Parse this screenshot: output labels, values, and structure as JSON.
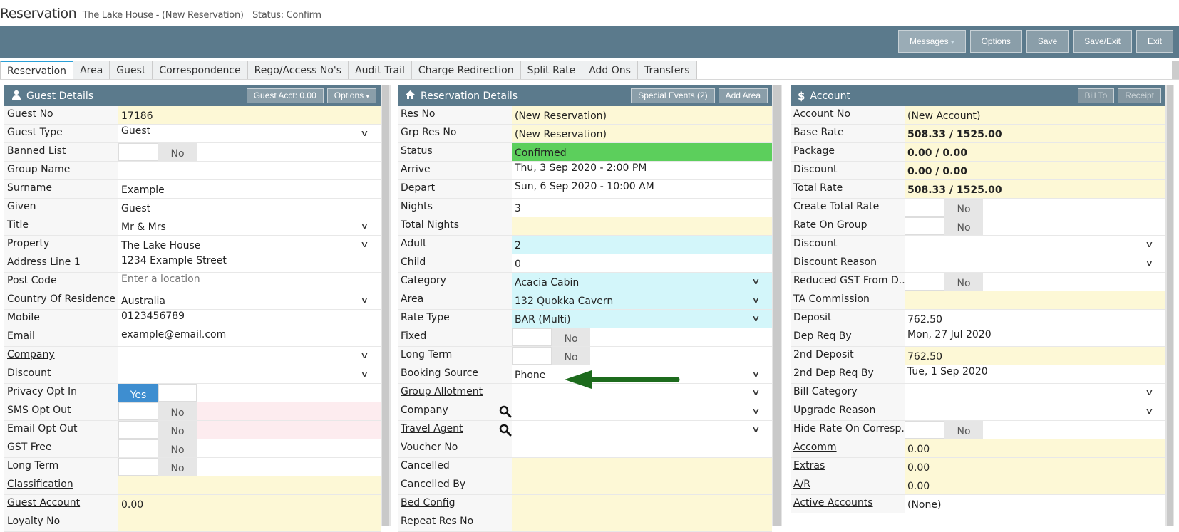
{
  "title": {
    "main": "Reservation",
    "property": "The Lake House - (New Reservation)",
    "status": "Status: Confirm"
  },
  "toolbar": {
    "buttons": [
      "Messages",
      "Options",
      "Save",
      "Save/Exit",
      "Exit"
    ]
  },
  "tabs": [
    "Reservation",
    "Area",
    "Guest",
    "Correspondence",
    "Rego/Access No's",
    "Audit Trail",
    "Charge Redirection",
    "Split Rate",
    "Add Ons",
    "Transfers"
  ],
  "guest": {
    "title": "Guest Details",
    "btn_acct": "Guest Acct: 0.00",
    "btn_options": "Options",
    "rows": [
      {
        "label": "Guest No",
        "value": "17186"
      },
      {
        "label": "Guest Type",
        "value": "Guest"
      },
      {
        "label": "Banned List",
        "value": "No"
      },
      {
        "label": "Group Name",
        "value": ""
      },
      {
        "label": "Surname",
        "value": "Example"
      },
      {
        "label": "Given",
        "value": "Guest"
      },
      {
        "label": "Title",
        "value": "Mr & Mrs"
      },
      {
        "label": "Property",
        "value": "The Lake House"
      },
      {
        "label": "Address Line 1",
        "value": "1234 Example Street"
      },
      {
        "label": "Post Code",
        "value": "Enter a location"
      },
      {
        "label": "Country Of Residence",
        "value": "Australia"
      },
      {
        "label": "Mobile",
        "value": "0123456789"
      },
      {
        "label": "Email",
        "value": "example@email.com"
      },
      {
        "label": "Company",
        "value": ""
      },
      {
        "label": "Discount",
        "value": ""
      },
      {
        "label": "Privacy Opt In",
        "value": "Yes"
      },
      {
        "label": "SMS Opt Out",
        "value": "No"
      },
      {
        "label": "Email Opt Out",
        "value": "No"
      },
      {
        "label": "GST Free",
        "value": "No"
      },
      {
        "label": "Long Term",
        "value": "No"
      },
      {
        "label": "Classification",
        "value": ""
      },
      {
        "label": "Guest Account",
        "value": "0.00"
      },
      {
        "label": "Loyalty No",
        "value": ""
      }
    ]
  },
  "res": {
    "title": "Reservation Details",
    "btn_events": "Special Events (2)",
    "btn_area": "Add Area",
    "rows": [
      {
        "label": "Res No",
        "value": "(New Reservation)"
      },
      {
        "label": "Grp Res No",
        "value": "(New Reservation)"
      },
      {
        "label": "Status",
        "value": "Confirmed"
      },
      {
        "label": "Arrive",
        "value": "Thu, 3 Sep 2020 - 2:00 PM"
      },
      {
        "label": "Depart",
        "value": "Sun, 6 Sep 2020 - 10:00 AM"
      },
      {
        "label": "Nights",
        "value": "3"
      },
      {
        "label": "Total Nights",
        "value": ""
      },
      {
        "label": "Adult",
        "value": "2"
      },
      {
        "label": "Child",
        "value": "0"
      },
      {
        "label": "Category",
        "value": "Acacia Cabin"
      },
      {
        "label": "Area",
        "value": "132 Quokka Cavern"
      },
      {
        "label": "Rate Type",
        "value": "BAR (Multi)"
      },
      {
        "label": "Fixed",
        "value": "No"
      },
      {
        "label": "Long Term",
        "value": "No"
      },
      {
        "label": "Booking Source",
        "value": "Phone"
      },
      {
        "label": "Group Allotment",
        "value": ""
      },
      {
        "label": "Company",
        "value": ""
      },
      {
        "label": "Travel Agent",
        "value": ""
      },
      {
        "label": "Voucher No",
        "value": ""
      },
      {
        "label": "Cancelled",
        "value": ""
      },
      {
        "label": "Cancelled By",
        "value": ""
      },
      {
        "label": "Bed Config",
        "value": ""
      },
      {
        "label": "Repeat Res No",
        "value": ""
      }
    ]
  },
  "acct": {
    "title": "Account",
    "btn_billto": "Bill To",
    "btn_receipt": "Receipt",
    "rows": [
      {
        "label": "Account No",
        "value": "(New Account)"
      },
      {
        "label": "Base Rate",
        "value": "508.33 / 1525.00"
      },
      {
        "label": "Package",
        "value": "0.00 / 0.00"
      },
      {
        "label": "Discount",
        "value": "0.00 / 0.00"
      },
      {
        "label": "Total Rate",
        "value": "508.33 / 1525.00"
      },
      {
        "label": "Create Total Rate",
        "value": "No"
      },
      {
        "label": "Rate On Group",
        "value": "No"
      },
      {
        "label": "Discount",
        "value": ""
      },
      {
        "label": "Discount Reason",
        "value": ""
      },
      {
        "label": "Reduced GST From D...",
        "value": "No"
      },
      {
        "label": "TA Commission",
        "value": ""
      },
      {
        "label": "Deposit",
        "value": "762.50"
      },
      {
        "label": "Dep Req By",
        "value": "Mon, 27 Jul 2020"
      },
      {
        "label": "2nd Deposit",
        "value": "762.50"
      },
      {
        "label": "2nd Dep Req By",
        "value": "Tue, 1 Sep 2020"
      },
      {
        "label": "Bill Category",
        "value": ""
      },
      {
        "label": "Upgrade Reason",
        "value": ""
      },
      {
        "label": "Hide Rate On Corresp...",
        "value": "No"
      },
      {
        "label": "Accomm",
        "value": "0.00"
      },
      {
        "label": "Extras",
        "value": "0.00"
      },
      {
        "label": "A/R",
        "value": "0.00"
      },
      {
        "label": "Active Accounts",
        "value": "(None)"
      }
    ]
  },
  "icons": {
    "guest": "user-icon",
    "res": "home-icon",
    "acct": "dollar-icon",
    "search": "search-icon",
    "dropdown": "chevron-down-icon",
    "annotation": "arrow-left-annotation"
  },
  "colors": {
    "header": "#5b7a8c",
    "highlight_yellow": "#fdf8d6",
    "highlight_cyan": "#d3f6fa",
    "status_green": "#5ccf5c",
    "toggle_on": "#3e8ed0",
    "arrow": "#1d6b1d"
  }
}
